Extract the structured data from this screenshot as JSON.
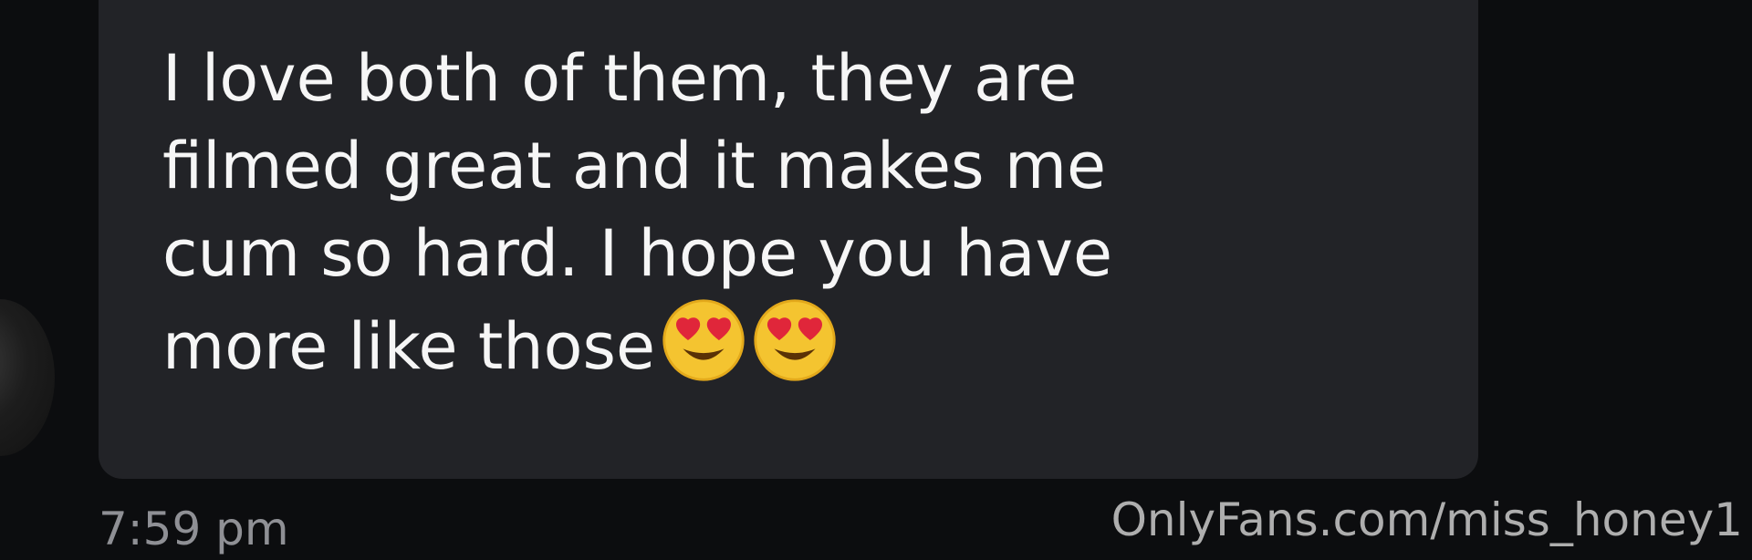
{
  "message": {
    "text": "I love both of them, they are\nfilmed great and it makes me\ncum so hard. I hope you have\nmore like those",
    "emojis": [
      "smiling-face-with-heart-eyes",
      "smiling-face-with-heart-eyes"
    ]
  },
  "timestamp": "7:59 pm",
  "watermark": "OnlyFans.com/miss_honey1",
  "colors": {
    "background": "#0c0d0f",
    "bubble": "#222327",
    "message_text": "#f6f6f6",
    "timestamp": "#8f9095"
  }
}
